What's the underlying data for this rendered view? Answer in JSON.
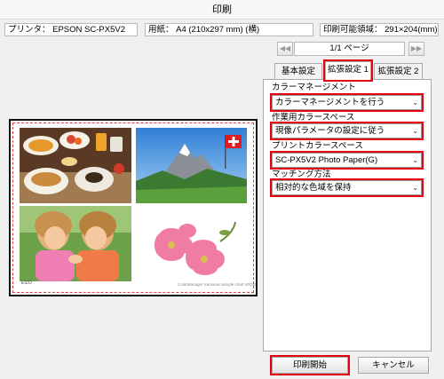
{
  "window": {
    "title": "印刷"
  },
  "info": {
    "printer": "プリンタ：  EPSON SC-PX5V2",
    "paper": "用紙：  A4 (210x297 mm) (横)",
    "printable": "印刷可能領域：  291×204(mm)"
  },
  "pager": {
    "first": "◀◀",
    "last": "▶▶",
    "indicator": "1/1 ページ"
  },
  "tabs": [
    {
      "label": "基本設定",
      "active": false
    },
    {
      "label": "拡張設定 1",
      "active": true
    },
    {
      "label": "拡張設定 2",
      "active": false
    }
  ],
  "settings": {
    "color_management": {
      "label": "カラーマネージメント",
      "value": "カラーマネージメントを行う"
    },
    "working_space": {
      "label": "作業用カラースペース",
      "value": "現像パラメータの設定に従う"
    },
    "print_space": {
      "label": "プリントカラースペース",
      "value": "SC-PX5V2 Photo Paper(G)"
    },
    "matching": {
      "label": "マッチング方法",
      "value": "相対的な色域を保持"
    }
  },
  "preview": {
    "caption": "ColorManager Kansena sample chart sRGB",
    "logo": "EIZO"
  },
  "buttons": {
    "print": "印刷開始",
    "cancel": "キャンセル"
  },
  "colors": {
    "highlight": "#e60012"
  }
}
